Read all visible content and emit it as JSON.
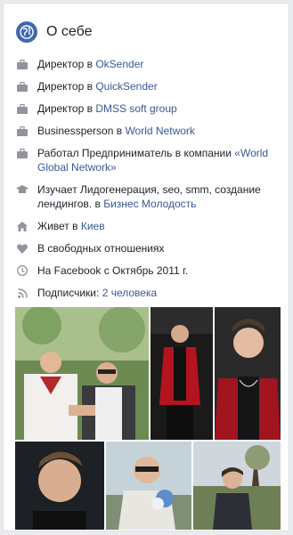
{
  "header": {
    "title": "О себе"
  },
  "rows": [
    {
      "icon": "briefcase-icon",
      "pre": "Директор в ",
      "link": "OkSender",
      "post": ""
    },
    {
      "icon": "briefcase-icon",
      "pre": "Директор в ",
      "link": "QuickSender",
      "post": ""
    },
    {
      "icon": "briefcase-icon",
      "pre": "Директор в ",
      "link": "DMSS soft group",
      "post": ""
    },
    {
      "icon": "briefcase-icon",
      "pre": "Businessperson в ",
      "link": "World Network",
      "post": ""
    },
    {
      "icon": "briefcase-icon",
      "pre": "Работал Предприниматель в компании ",
      "link": "«World Global Network»",
      "post": ""
    },
    {
      "icon": "education-icon",
      "pre": "Изучает Лидогенерация, seo, smm, создание лендингов. в ",
      "link": "Бизнес Молодость",
      "post": ""
    },
    {
      "icon": "home-icon",
      "pre": "Живет в ",
      "link": "Киев",
      "post": ""
    },
    {
      "icon": "heart-icon",
      "pre": "В свободных отношениях",
      "link": "",
      "post": ""
    },
    {
      "icon": "clock-icon",
      "pre": "На Facebook с Октябрь 2011 г.",
      "link": "",
      "post": ""
    },
    {
      "icon": "rss-icon",
      "pre": "Подписчики: ",
      "link": "2 человека",
      "post": ""
    }
  ],
  "photos": [
    {
      "name": "photo-two-men-outdoor"
    },
    {
      "name": "photo-man-red-jacket"
    },
    {
      "name": "photo-man-red-jacket-closeup"
    },
    {
      "name": "photo-selfie-man-dark"
    },
    {
      "name": "photo-man-sunglasses-flowers"
    },
    {
      "name": "photo-man-park"
    }
  ]
}
